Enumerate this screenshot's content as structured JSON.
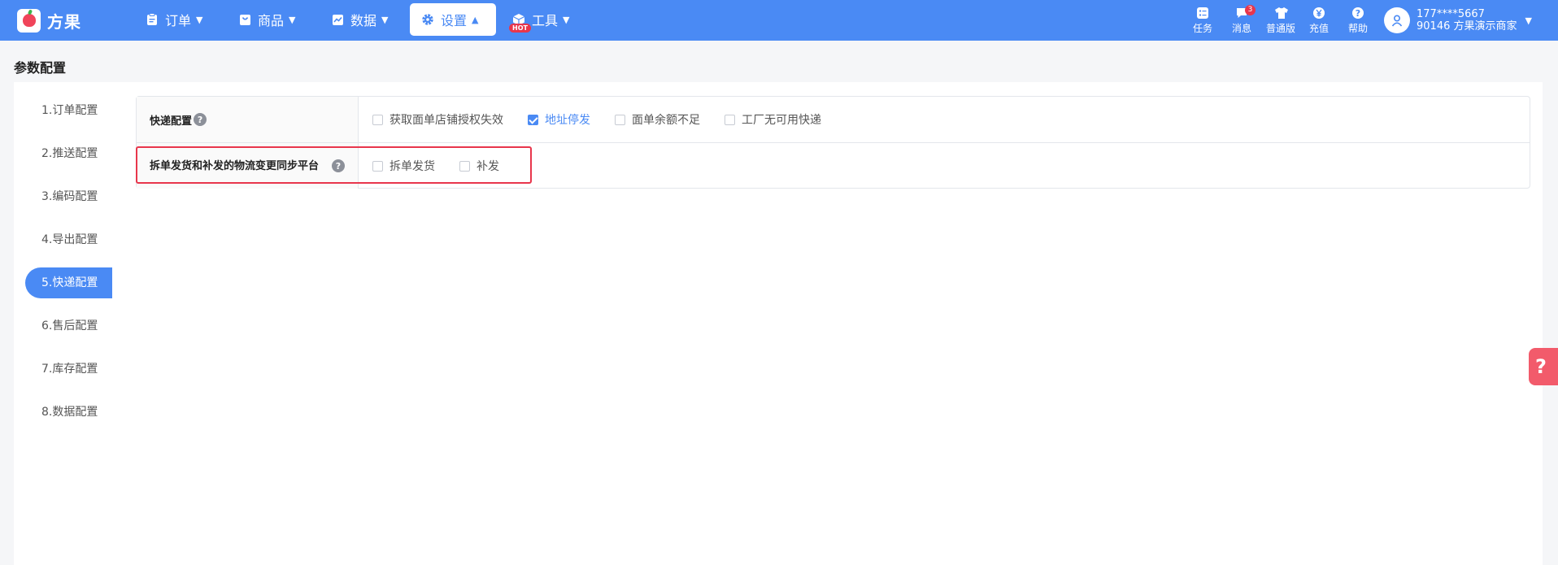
{
  "brand": {
    "name": "方果"
  },
  "nav": {
    "items": [
      {
        "label": "订单",
        "icon": "clipboard-icon"
      },
      {
        "label": "商品",
        "icon": "bag-icon"
      },
      {
        "label": "数据",
        "icon": "chart-icon"
      },
      {
        "label": "设置",
        "icon": "gear-icon",
        "active": true
      },
      {
        "label": "工具",
        "icon": "box-icon",
        "badge": "HOT"
      }
    ]
  },
  "toolbar": {
    "items": [
      {
        "label": "任务",
        "icon": "task-icon"
      },
      {
        "label": "消息",
        "icon": "message-icon",
        "badge": "3"
      },
      {
        "label": "普通版",
        "icon": "shirt-icon"
      },
      {
        "label": "充值",
        "icon": "yen-icon"
      },
      {
        "label": "帮助",
        "icon": "help-icon"
      }
    ]
  },
  "user": {
    "phone": "177****5667",
    "account": "90146 方果演示商家"
  },
  "page": {
    "title": "参数配置"
  },
  "sidebar": {
    "items": [
      {
        "label": "1.订单配置"
      },
      {
        "label": "2.推送配置"
      },
      {
        "label": "3.编码配置"
      },
      {
        "label": "4.导出配置"
      },
      {
        "label": "5.快递配置",
        "active": true
      },
      {
        "label": "6.售后配置"
      },
      {
        "label": "7.库存配置"
      },
      {
        "label": "8.数据配置"
      }
    ]
  },
  "config": {
    "rows": [
      {
        "label": "快递配置",
        "options": [
          {
            "label": "获取面单店铺授权失效",
            "checked": false
          },
          {
            "label": "地址停发",
            "checked": true
          },
          {
            "label": "面单余额不足",
            "checked": false
          },
          {
            "label": "工厂无可用快递",
            "checked": false
          }
        ]
      },
      {
        "label": "拆单发货和补发的物流变更同步平台",
        "options": [
          {
            "label": "拆单发货",
            "checked": false
          },
          {
            "label": "补发",
            "checked": false
          }
        ]
      }
    ]
  },
  "colors": {
    "primary": "#4a8af4",
    "danger": "#e8364c",
    "float_help": "#f25b6b"
  }
}
